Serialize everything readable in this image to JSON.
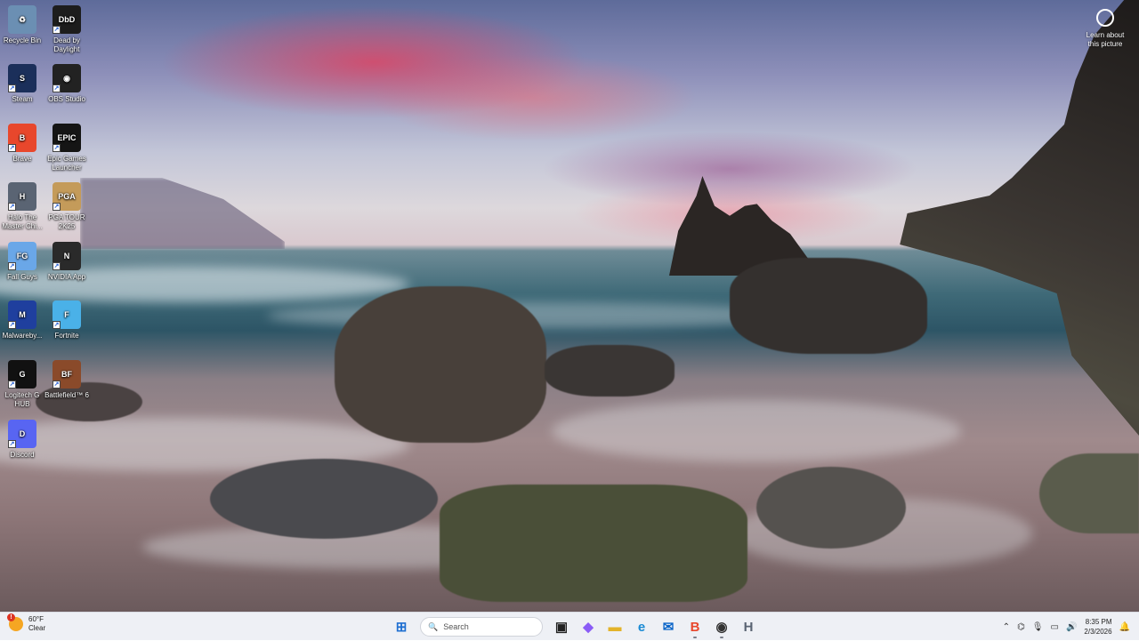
{
  "desktop": {
    "learn_about_picture": "Learn about this picture",
    "icons": [
      {
        "name": "recycle-bin",
        "label": "Recycle Bin",
        "glyph": "♻",
        "color": "#6b8fb3"
      },
      {
        "name": "dead-by-daylight",
        "label": "Dead by Daylight",
        "glyph": "DbD",
        "color": "#1d1d1d"
      },
      {
        "name": "steam",
        "label": "Steam",
        "glyph": "S",
        "color": "#1b2f5a"
      },
      {
        "name": "obs-studio",
        "label": "OBS Studio",
        "glyph": "◉",
        "color": "#222"
      },
      {
        "name": "brave",
        "label": "Brave",
        "glyph": "B",
        "color": "#e8472c"
      },
      {
        "name": "epic-games",
        "label": "Epic Games Launcher",
        "glyph": "EPIC",
        "color": "#151515"
      },
      {
        "name": "halo",
        "label": "Halo The Master Chi...",
        "glyph": "H",
        "color": "#5a6473"
      },
      {
        "name": "pga-tour",
        "label": "PGA TOUR 2K25",
        "glyph": "PGA",
        "color": "#c49b5a"
      },
      {
        "name": "fall-guys",
        "label": "Fall Guys",
        "glyph": "FG",
        "color": "#6aa7e8"
      },
      {
        "name": "nvidia-app",
        "label": "NVIDIA App",
        "glyph": "N",
        "color": "#2a2a2a"
      },
      {
        "name": "malwarebytes",
        "label": "Malwareby...",
        "glyph": "M",
        "color": "#1f3f9e"
      },
      {
        "name": "fortnite",
        "label": "Fortnite",
        "glyph": "F",
        "color": "#4ab1e8"
      },
      {
        "name": "logitech-g-hub",
        "label": "Logitech G HUB",
        "glyph": "G",
        "color": "#111"
      },
      {
        "name": "battlefield-6",
        "label": "Battlefield™ 6",
        "glyph": "BF",
        "color": "#8a4a2a"
      },
      {
        "name": "discord",
        "label": "Discord",
        "glyph": "D",
        "color": "#5865f2"
      }
    ]
  },
  "taskbar": {
    "weather": {
      "temp": "60°F",
      "condition": "Clear",
      "alert": "!"
    },
    "search_placeholder": "Search",
    "apps": [
      {
        "name": "start",
        "glyph": "⊞",
        "color": "#1f6fd1"
      },
      {
        "name": "task-view",
        "glyph": "▣",
        "color": "#222"
      },
      {
        "name": "copilot",
        "glyph": "◆",
        "color": "#8a5cf6"
      },
      {
        "name": "file-explorer",
        "glyph": "▬",
        "color": "#e3b32a"
      },
      {
        "name": "edge",
        "glyph": "e",
        "color": "#1a8ad4"
      },
      {
        "name": "outlook",
        "glyph": "✉",
        "color": "#0a64c8"
      },
      {
        "name": "brave",
        "glyph": "B",
        "color": "#e8472c"
      },
      {
        "name": "obs",
        "glyph": "◉",
        "color": "#333"
      },
      {
        "name": "halo",
        "glyph": "H",
        "color": "#5a6473"
      }
    ],
    "clock": {
      "time": "8:35 PM",
      "date": "2/3/2026"
    }
  }
}
